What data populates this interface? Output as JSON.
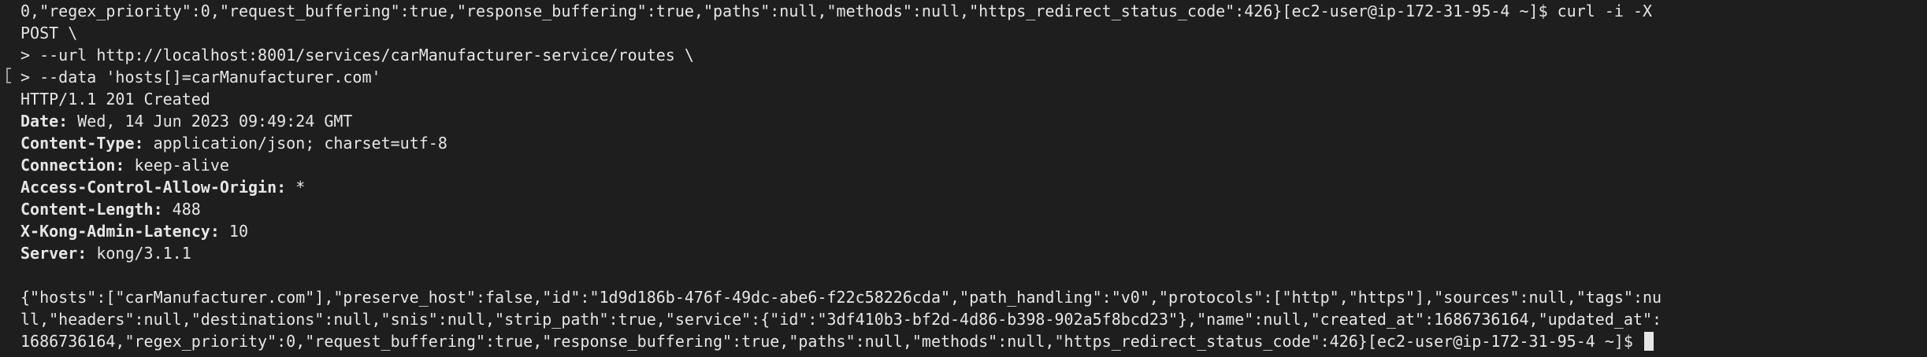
{
  "terminal": {
    "lines": {
      "l0": "0,\"regex_priority\":0,\"request_buffering\":true,\"response_buffering\":true,\"paths\":null,\"methods\":null,\"https_redirect_status_code\":426}[ec2-user@ip-172-31-95-4 ~]$ curl -i -X",
      "l1": "POST \\",
      "l2": "> --url http://localhost:8001/services/carManufacturer-service/routes \\",
      "l3": "> --data 'hosts[]=carManufacturer.com'",
      "l4": "HTTP/1.1 201 Created",
      "l13a": "{\"hosts\":[\"carManufacturer.com\"],\"preserve_host\":false,\"id\":\"1d9d186b-476f-49dc-abe6-f22c58226cda\",\"path_handling\":\"v0\",\"protocols\":[\"http\",\"https\"],\"sources\":null,\"tags\":nu",
      "l13b": "ll,\"headers\":null,\"destinations\":null,\"snis\":null,\"strip_path\":true,\"service\":{\"id\":\"3df410b3-bf2d-4d86-b398-902a5f8bcd23\"},\"name\":null,\"created_at\":1686736164,\"updated_at\":",
      "l13c": "1686736164,\"regex_priority\":0,\"request_buffering\":true,\"response_buffering\":true,\"paths\":null,\"methods\":null,\"https_redirect_status_code\":426}[ec2-user@ip-172-31-95-4 ~]$ "
    },
    "headers": [
      {
        "name": "Date:",
        "value": " Wed, 14 Jun 2023 09:49:24 GMT"
      },
      {
        "name": "Content-Type:",
        "value": " application/json; charset=utf-8"
      },
      {
        "name": "Connection:",
        "value": " keep-alive"
      },
      {
        "name": "Access-Control-Allow-Origin:",
        "value": " *"
      },
      {
        "name": "Content-Length:",
        "value": " 488"
      },
      {
        "name": "X-Kong-Admin-Latency:",
        "value": " 10"
      },
      {
        "name": "Server:",
        "value": " kong/3.1.1"
      }
    ]
  }
}
